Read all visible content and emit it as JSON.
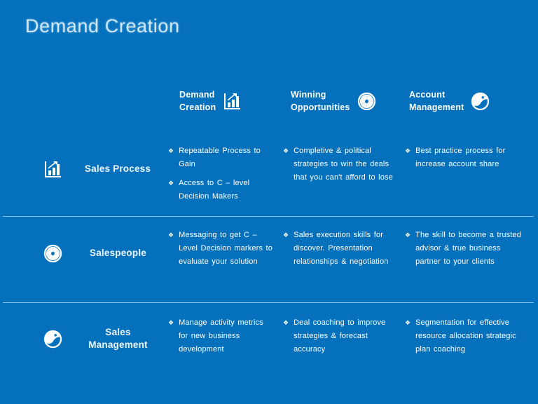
{
  "slide": {
    "title": "Demand Creation",
    "background_color": "#0571bd",
    "title_color": "#cfe7f7",
    "divider_color": "#9fd0ee",
    "text_color": "#ffffff",
    "bullet_glyph": "❖"
  },
  "columns": [
    {
      "label": "Demand\nCreation",
      "icon": "bar-chart-growth-icon"
    },
    {
      "label": "Winning\nOpportunities",
      "icon": "aperture-icon"
    },
    {
      "label": "Account\nManagement",
      "icon": "globe-icon"
    }
  ],
  "rows": [
    {
      "label": "Sales Process",
      "icon": "bar-chart-growth-icon"
    },
    {
      "label": "Salespeople",
      "icon": "aperture-icon"
    },
    {
      "label": "Sales\nManagement",
      "icon": "globe-icon"
    }
  ],
  "matrix": [
    [
      {
        "bullets": [
          "Repeatable Process to Gain",
          "Access to C – level Decision Makers"
        ]
      },
      {
        "bullets": [
          "Completive & political strategies to win the deals that you can't afford to lose"
        ]
      },
      {
        "bullets": [
          "Best practice process for increase account share"
        ]
      }
    ],
    [
      {
        "bullets": [
          "Messaging to get C – Level Decision markers to evaluate your solution"
        ]
      },
      {
        "bullets": [
          "Sales execution skills for discover. Presentation relationships & negotiation"
        ]
      },
      {
        "bullets": [
          "The skill to become a trusted advisor & true business partner to your clients"
        ]
      }
    ],
    [
      {
        "bullets": [
          "Manage activity metrics for new business development"
        ]
      },
      {
        "bullets": [
          "Deal coaching to improve strategies & forecast accuracy"
        ]
      },
      {
        "bullets": [
          "Segmentation for effective resource allocation strategic plan coaching"
        ]
      }
    ]
  ]
}
